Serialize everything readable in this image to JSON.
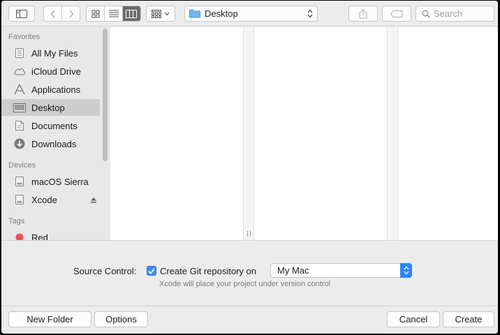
{
  "toolbar": {
    "path_label": "Desktop",
    "search_placeholder": "Search"
  },
  "sidebar": {
    "favorites_heading": "Favorites",
    "favorites": [
      {
        "label": "All My Files",
        "icon": "all-files-icon"
      },
      {
        "label": "iCloud Drive",
        "icon": "cloud-icon"
      },
      {
        "label": "Applications",
        "icon": "applications-icon"
      },
      {
        "label": "Desktop",
        "icon": "desktop-icon",
        "selected": true
      },
      {
        "label": "Documents",
        "icon": "document-icon"
      },
      {
        "label": "Downloads",
        "icon": "download-icon"
      }
    ],
    "devices_heading": "Devices",
    "devices": [
      {
        "label": "macOS Sierra",
        "icon": "disk-icon"
      },
      {
        "label": "Xcode",
        "icon": "disk-icon",
        "ejectable": true
      }
    ],
    "tags_heading": "Tags",
    "tags": [
      {
        "label": "Red",
        "color": "#f25056"
      }
    ]
  },
  "options": {
    "source_control_label": "Source Control:",
    "git_checkbox_label": "Create Git repository on",
    "git_checked": true,
    "repository_location": "My Mac",
    "hint": "Xcode will place your project under version control"
  },
  "buttons": {
    "new_folder": "New Folder",
    "options": "Options",
    "cancel": "Cancel",
    "create": "Create"
  },
  "colors": {
    "accent": "#2f86f6",
    "sidebar_selected": "#cdcdcd"
  }
}
